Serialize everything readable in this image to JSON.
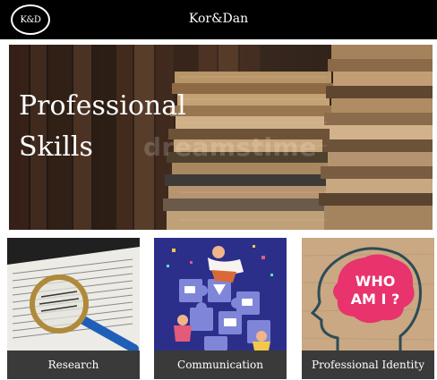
{
  "header": {
    "logo_text": "K&D",
    "site_title": "Kor&Dan"
  },
  "hero": {
    "title_line1": "Professional",
    "title_line2": "Skills",
    "watermark": "dreamstime",
    "image": "stacked-old-books"
  },
  "cards": [
    {
      "label": "Research",
      "image": "magnifying-glass-on-newspaper"
    },
    {
      "label": "Communication",
      "image": "puzzle-pieces-people",
      "selected": true
    },
    {
      "label": "Professional Identity",
      "image": "head-silhouette-who-am-i"
    }
  ],
  "card_image_text": {
    "identity_line1": "WHO",
    "identity_line2": "AM I ?"
  },
  "colors": {
    "header_bg": "#000000",
    "selected_outline": "#2d8fe6",
    "label_bg": "#3a3a3a"
  }
}
